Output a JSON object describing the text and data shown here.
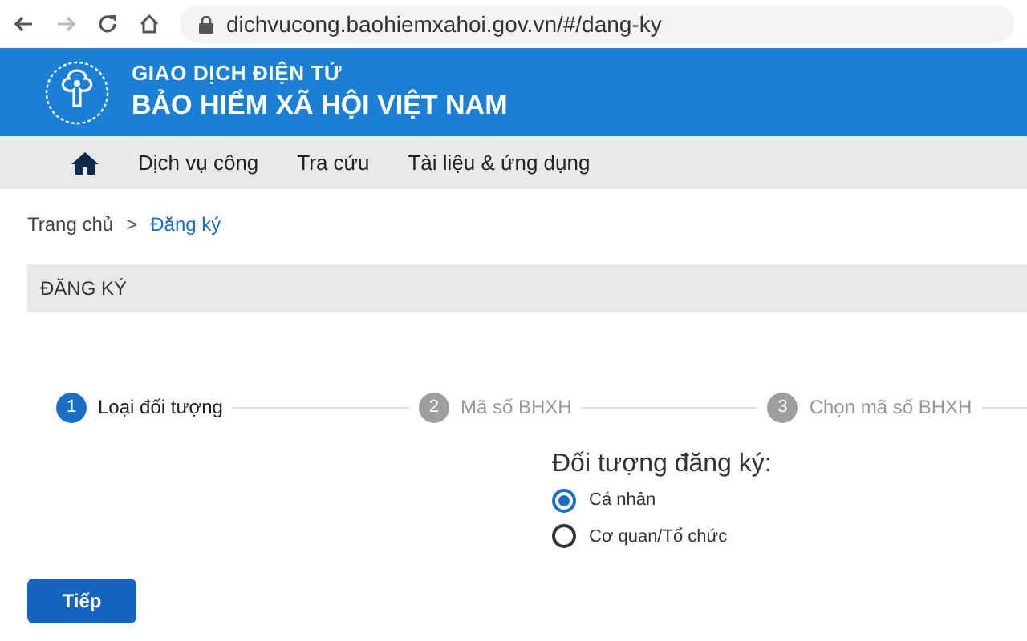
{
  "browser": {
    "url": "dichvucong.baohiemxahoi.gov.vn/#/dang-ky"
  },
  "header": {
    "subtitle": "GIAO DỊCH ĐIỆN TỬ",
    "title": "BẢO HIỂM XÃ HỘI VIỆT NAM"
  },
  "nav": {
    "items": [
      {
        "label": "Dịch vụ công"
      },
      {
        "label": "Tra cứu"
      },
      {
        "label": "Tài liệu & ứng dụng"
      }
    ]
  },
  "breadcrumb": [
    {
      "label": "Trang chủ",
      "current": false
    },
    {
      "label": "Đăng ký",
      "current": true
    }
  ],
  "breadcrumb_separator": ">",
  "section_title": "ĐĂNG KÝ",
  "steps": [
    {
      "number": "1",
      "label": "Loại đối tượng",
      "selected": true
    },
    {
      "number": "2",
      "label": "Mã số BHXH",
      "selected": false
    },
    {
      "number": "3",
      "label": "Chọn mã số BHXH",
      "selected": false
    }
  ],
  "form": {
    "label": "Đối tượng đăng ký:",
    "options": [
      {
        "label": "Cá nhân",
        "selected": true
      },
      {
        "label": "Cơ quan/Tổ chức",
        "selected": false
      }
    ]
  },
  "next_button": "Tiếp"
}
